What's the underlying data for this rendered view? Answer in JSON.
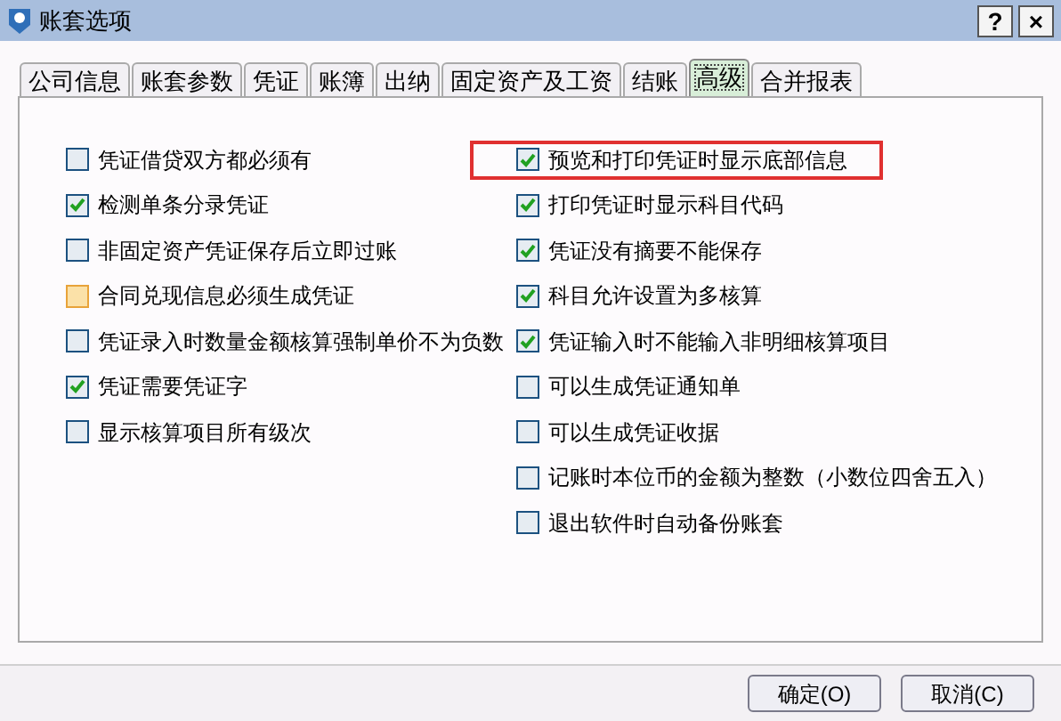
{
  "window": {
    "title": "账套选项",
    "buttons": [
      "?",
      "×"
    ]
  },
  "tabs": [
    {
      "label": "公司信息",
      "selected": false
    },
    {
      "label": "账套参数",
      "selected": false
    },
    {
      "label": "凭证",
      "selected": false
    },
    {
      "label": "账簿",
      "selected": false
    },
    {
      "label": "出纳",
      "selected": false
    },
    {
      "label": "固定资产及工资",
      "selected": false
    },
    {
      "label": "结账",
      "selected": false
    },
    {
      "label": "高级",
      "selected": true
    },
    {
      "label": "合并报表",
      "selected": false
    }
  ],
  "left_options": [
    {
      "label": "凭证借贷双方都必须有",
      "checked": false,
      "hot": false
    },
    {
      "label": "检测单条分录凭证",
      "checked": true,
      "hot": false
    },
    {
      "label": "非固定资产凭证保存后立即过账",
      "checked": false,
      "hot": false
    },
    {
      "label": "合同兑现信息必须生成凭证",
      "checked": false,
      "hot": true
    },
    {
      "label": "凭证录入时数量金额核算强制单价不为负数",
      "checked": false,
      "hot": false
    },
    {
      "label": "凭证需要凭证字",
      "checked": true,
      "hot": false
    },
    {
      "label": "显示核算项目所有级次",
      "checked": false,
      "hot": false
    }
  ],
  "right_options": [
    {
      "label": "预览和打印凭证时显示底部信息",
      "checked": true,
      "highlighted": true
    },
    {
      "label": "打印凭证时显示科目代码",
      "checked": true,
      "highlighted": false
    },
    {
      "label": "凭证没有摘要不能保存",
      "checked": true,
      "highlighted": false
    },
    {
      "label": "科目允许设置为多核算",
      "checked": true,
      "highlighted": false
    },
    {
      "label": "凭证输入时不能输入非明细核算项目",
      "checked": true,
      "highlighted": false
    },
    {
      "label": "可以生成凭证通知单",
      "checked": false,
      "highlighted": false
    },
    {
      "label": "可以生成凭证收据",
      "checked": false,
      "highlighted": false
    },
    {
      "label": "记账时本位币的金额为整数（小数位四舍五入）",
      "checked": false,
      "highlighted": false
    },
    {
      "label": "退出软件时自动备份账套",
      "checked": false,
      "highlighted": false
    }
  ],
  "buttons": [
    "确定(O)",
    "取消(C)"
  ]
}
